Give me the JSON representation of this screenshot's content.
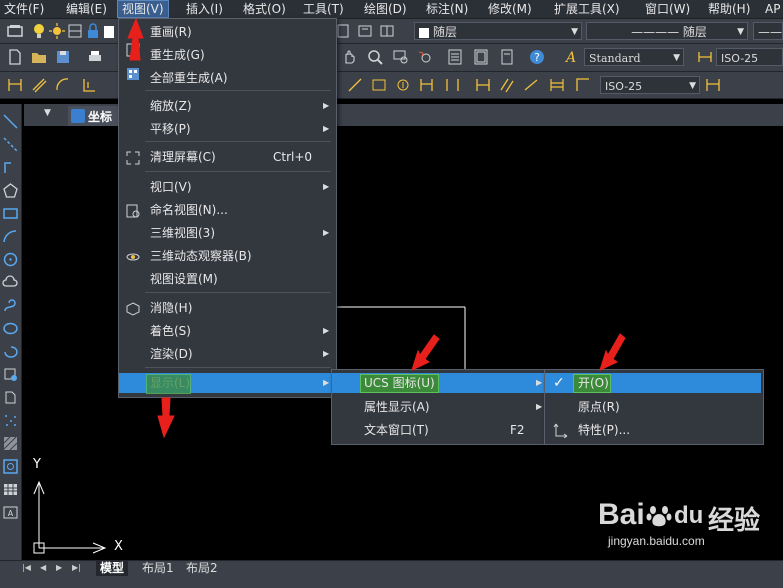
{
  "menubar": {
    "items": [
      "文件(F)",
      "编辑(E)",
      "视图(V)",
      "插入(I)",
      "格式(O)",
      "工具(T)",
      "绘图(D)",
      "标注(N)",
      "修改(M)",
      "扩展工具(X)",
      "窗口(W)",
      "帮助(H)",
      "AP"
    ]
  },
  "toolbar": {
    "layer_combo": "随层",
    "linetype_combo": "———— 随层",
    "text_style_combo": "Standard",
    "dim_style_combo": "ISO-25",
    "dim_style_combo2": "ISO-25"
  },
  "doc_tab": {
    "label": "坐标"
  },
  "view_menu": {
    "items": [
      {
        "label": "重画(R)",
        "shortcut": "",
        "submenu": false
      },
      {
        "label": "重生成(G)",
        "shortcut": "",
        "submenu": false
      },
      {
        "label": "全部重生成(A)",
        "shortcut": "",
        "submenu": false
      },
      {
        "label": "缩放(Z)",
        "shortcut": "",
        "submenu": true
      },
      {
        "label": "平移(P)",
        "shortcut": "",
        "submenu": true
      },
      {
        "label": "清理屏幕(C)",
        "shortcut": "Ctrl+0",
        "submenu": false
      },
      {
        "label": "视口(V)",
        "shortcut": "",
        "submenu": true
      },
      {
        "label": "命名视图(N)...",
        "shortcut": "",
        "submenu": false
      },
      {
        "label": "三维视图(3)",
        "shortcut": "",
        "submenu": true
      },
      {
        "label": "三维动态观察器(B)",
        "shortcut": "",
        "submenu": false
      },
      {
        "label": "视图设置(M)",
        "shortcut": "",
        "submenu": false
      },
      {
        "label": "消隐(H)",
        "shortcut": "",
        "submenu": false
      },
      {
        "label": "着色(S)",
        "shortcut": "",
        "submenu": true
      },
      {
        "label": "渲染(D)",
        "shortcut": "",
        "submenu": true
      },
      {
        "label": "显示(L)",
        "shortcut": "",
        "submenu": true
      }
    ]
  },
  "display_menu": {
    "items": [
      {
        "label": "UCS 图标(U)",
        "shortcut": "",
        "submenu": true
      },
      {
        "label": "属性显示(A)",
        "shortcut": "",
        "submenu": true
      },
      {
        "label": "文本窗口(T)",
        "shortcut": "F2",
        "submenu": false
      }
    ]
  },
  "ucs_menu": {
    "items": [
      {
        "label": "开(O)",
        "checked": true
      },
      {
        "label": "原点(R)",
        "checked": false
      },
      {
        "label": "特性(P)...",
        "checked": false
      }
    ]
  },
  "canvas": {
    "axis_y": "Y",
    "axis_x": "X"
  },
  "bottom_tabs": [
    "模型",
    "布局1",
    "布局2"
  ],
  "watermark": {
    "brand": "Bai",
    "du": "du",
    "jing": "经验",
    "url": "jingyan.baidu.com"
  },
  "colors": {
    "highlight": "#2e8bdc",
    "annotation_arrow": "#e8201c",
    "green_box": "#3a8a3a"
  }
}
